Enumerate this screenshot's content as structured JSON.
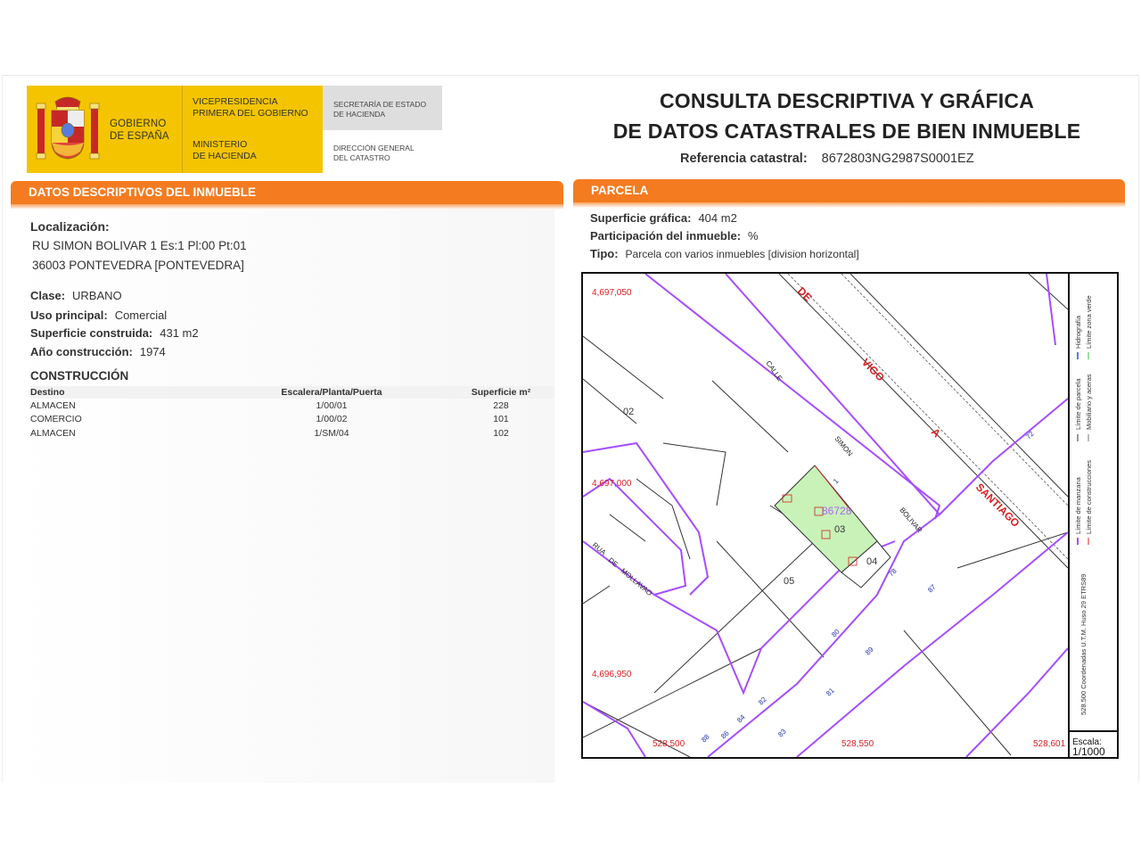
{
  "header": {
    "gobierno": [
      "GOBIERNO",
      "DE ESPAÑA"
    ],
    "vicepresidencia": [
      "VICEPRESIDENCIA",
      "PRIMERA DEL GOBIERNO"
    ],
    "ministerio": [
      "MINISTERIO",
      "DE HACIENDA"
    ],
    "secretaria": [
      "SECRETARÍA DE ESTADO",
      "DE HACIENDA"
    ],
    "direccion": [
      "DIRECCIÓN GENERAL",
      "DEL CATASTRO"
    ],
    "title_line1": "CONSULTA DESCRIPTIVA Y GRÁFICA",
    "title_line2": "DE DATOS CATASTRALES DE BIEN INMUEBLE",
    "ref_label": "Referencia catastral:",
    "ref_value": "8672803NG2987S0001EZ"
  },
  "left": {
    "bar_title": "DATOS DESCRIPTIVOS DEL INMUEBLE",
    "loc_label": "Localización:",
    "loc_line1": "RU SIMON BOLIVAR 1 Es:1 Pl:00 Pt:01",
    "loc_line2": "36003 PONTEVEDRA [PONTEVEDRA]",
    "clase_label": "Clase:",
    "clase_value": "URBANO",
    "uso_label": "Uso principal:",
    "uso_value": "Comercial",
    "sup_label": "Superficie construida:",
    "sup_value": "431 m2",
    "anio_label": "Año construcción:",
    "anio_value": "1974",
    "constr_title": "CONSTRUCCIÓN",
    "table_headers": [
      "Destino",
      "Escalera/Planta/Puerta",
      "Superficie m²"
    ],
    "rows": [
      [
        "ALMACEN",
        "1/00/01",
        "228"
      ],
      [
        "COMERCIO",
        "1/00/02",
        "101"
      ],
      [
        "ALMACEN",
        "1/SM/04",
        "102"
      ]
    ]
  },
  "right": {
    "bar_title": "PARCELA",
    "sup_label": "Superficie gráfica:",
    "sup_value": "404 m2",
    "part_label": "Participación del inmueble:",
    "part_value": "%",
    "tipo_label": "Tipo:",
    "tipo_value": "Parcela con varios inmuebles [division horizontal]"
  },
  "map": {
    "coord_top": "4,697,050",
    "coord_mid": "4,697,000",
    "coord_bot": "4,696,950",
    "x_left": "528,500",
    "x_mid": "528,550",
    "x_right": "528,601",
    "street_de": "DE",
    "street_vigo": "VIGO",
    "street_a": "A",
    "street_santiago": "SANTIAGO",
    "street_calle": "CALLE",
    "street_simon": "SIMON",
    "street_bolivar": "BOLIVAR",
    "street_rua": "RUA",
    "street_de2": "DE",
    "street_mollavao": "MOLLAVAO",
    "parcel_ref": "86728",
    "parcel_02": "02",
    "parcel_03": "03",
    "parcel_04": "04",
    "parcel_05": "05",
    "num_72": "72",
    "num_78": "78",
    "num_87": "87",
    "num_80": "80",
    "num_89": "89",
    "num_81": "81",
    "num_82": "82",
    "num_84": "84",
    "num_86": "86",
    "num_88": "88",
    "num_83": "83",
    "num_1": "1",
    "legend_coords": "528.500 Coordenadas U.T.M. Huso 29 ETRS89",
    "legend_manzana": "Límite de manzana",
    "legend_parcela": "Límite de parcela",
    "legend_hidro": "Hidrografía",
    "legend_constr": "Límite de construcciones",
    "legend_mobiliario": "Mobiliario y aceras",
    "legend_verde": "Límite zona verde",
    "scale_label": "Escala:",
    "scale_value": "1/1000"
  },
  "colors": {
    "orange": "#f47b20",
    "yellow": "#f5c400",
    "manzana": "#a64dff",
    "parcel_fill": "#c8f2b8",
    "coords": "#d92020",
    "numbers": "#2233aa"
  }
}
